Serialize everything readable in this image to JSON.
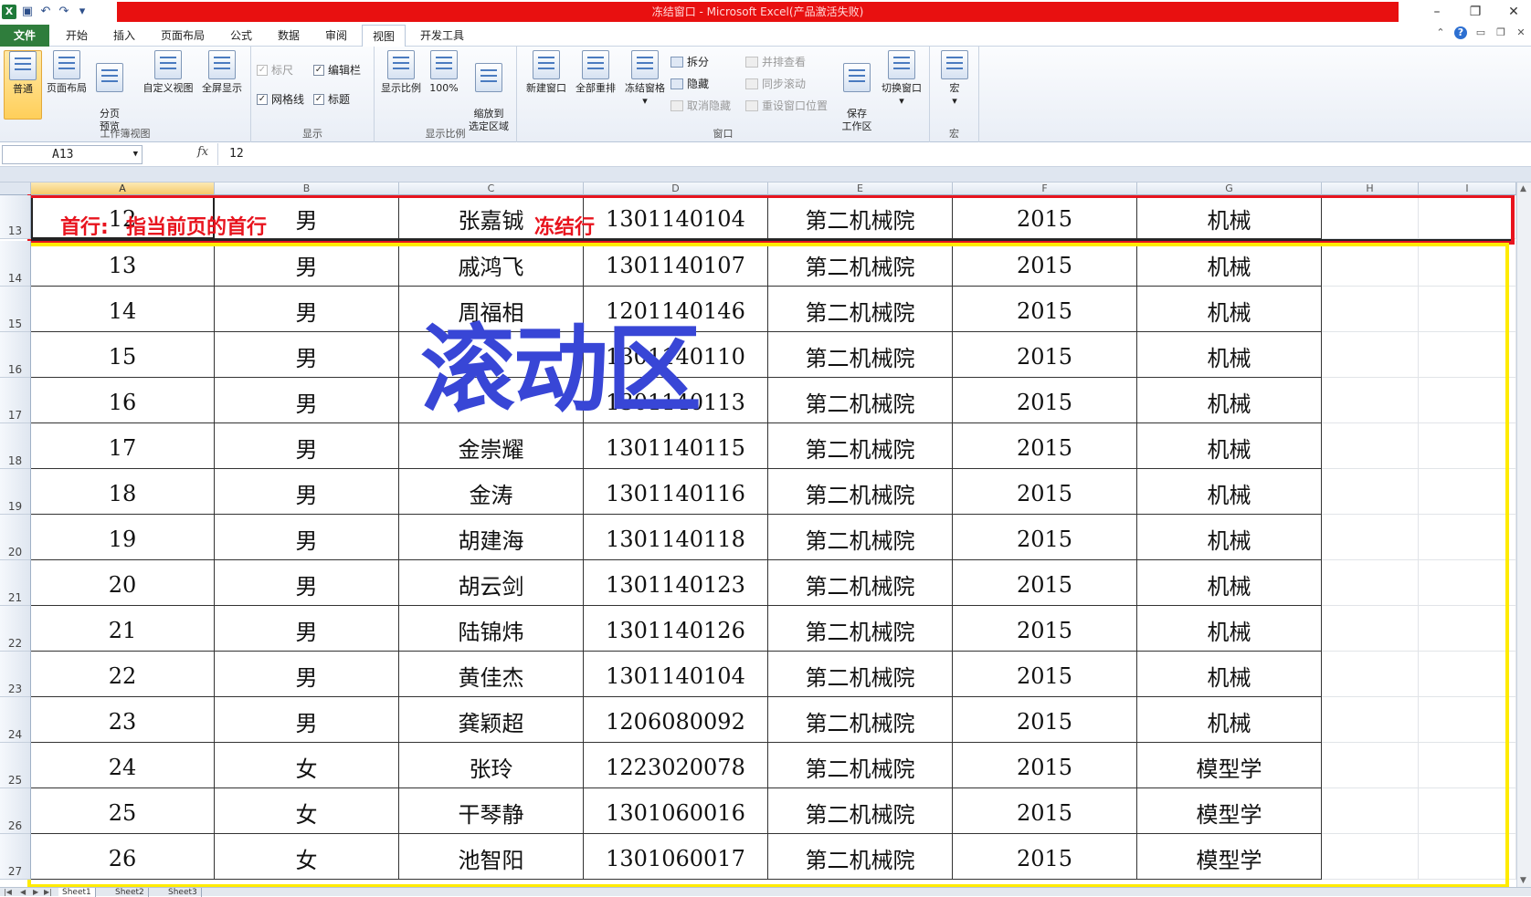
{
  "window": {
    "title": "冻结窗口 - Microsoft Excel(产品激活失败)",
    "controls": [
      "–",
      "❐",
      "✕"
    ]
  },
  "tabs": [
    "文件",
    "开始",
    "插入",
    "页面布局",
    "公式",
    "数据",
    "审阅",
    "视图",
    "开发工具"
  ],
  "ribbon": {
    "workbook_views": {
      "label": "工作簿视图",
      "normal": "普通",
      "page_layout": "页面布局",
      "page_break": "分页\n预览",
      "custom_views": "自定义视图",
      "full_screen": "全屏显示"
    },
    "show": {
      "label": "显示",
      "ruler": "标尺",
      "formula_bar": "编辑栏",
      "gridlines": "网格线",
      "headings": "标题"
    },
    "zoom": {
      "label": "显示比例",
      "zoom": "显示比例",
      "zoom100": "100%",
      "zoom_selection": "缩放到\n选定区域"
    },
    "window": {
      "label": "窗口",
      "new_window": "新建窗口",
      "arrange_all": "全部重排",
      "freeze_panes": "冻结窗格",
      "split": "拆分",
      "hide": "隐藏",
      "unhide": "取消隐藏",
      "side_by_side": "并排查看",
      "sync_scroll": "同步滚动",
      "reset_position": "重设窗口位置",
      "save_workspace": "保存\n工作区",
      "switch_windows": "切换窗口"
    },
    "macros": {
      "label": "宏",
      "macros": "宏"
    }
  },
  "formula_bar": {
    "name_box": "A13",
    "fx": "fx",
    "value": "12"
  },
  "columns": [
    "A",
    "B",
    "C",
    "D",
    "E",
    "F",
    "G",
    "H",
    "I"
  ],
  "rows": [
    {
      "num": "13",
      "cells": [
        "12",
        "男",
        "张嘉铖",
        "1301140104",
        "第二机械院",
        "2015",
        "机械"
      ]
    },
    {
      "num": "14",
      "cells": [
        "13",
        "男",
        "戚鸿飞",
        "1301140107",
        "第二机械院",
        "2015",
        "机械"
      ]
    },
    {
      "num": "15",
      "cells": [
        "14",
        "男",
        "周福相",
        "1201140146",
        "第二机械院",
        "2015",
        "机械"
      ]
    },
    {
      "num": "16",
      "cells": [
        "15",
        "男",
        "",
        "1301140110",
        "第二机械院",
        "2015",
        "机械"
      ]
    },
    {
      "num": "17",
      "cells": [
        "16",
        "男",
        "",
        "1301140113",
        "第二机械院",
        "2015",
        "机械"
      ]
    },
    {
      "num": "18",
      "cells": [
        "17",
        "男",
        "金崇耀",
        "1301140115",
        "第二机械院",
        "2015",
        "机械"
      ]
    },
    {
      "num": "19",
      "cells": [
        "18",
        "男",
        "金涛",
        "1301140116",
        "第二机械院",
        "2015",
        "机械"
      ]
    },
    {
      "num": "20",
      "cells": [
        "19",
        "男",
        "胡建海",
        "1301140118",
        "第二机械院",
        "2015",
        "机械"
      ]
    },
    {
      "num": "21",
      "cells": [
        "20",
        "男",
        "胡云剑",
        "1301140123",
        "第二机械院",
        "2015",
        "机械"
      ]
    },
    {
      "num": "22",
      "cells": [
        "21",
        "男",
        "陆锦炜",
        "1301140126",
        "第二机械院",
        "2015",
        "机械"
      ]
    },
    {
      "num": "23",
      "cells": [
        "22",
        "男",
        "黄佳杰",
        "1301140104",
        "第二机械院",
        "2015",
        "机械"
      ]
    },
    {
      "num": "24",
      "cells": [
        "23",
        "男",
        "龚颖超",
        "1206080092",
        "第二机械院",
        "2015",
        "机械"
      ]
    },
    {
      "num": "25",
      "cells": [
        "24",
        "女",
        "张玲",
        "1223020078",
        "第二机械院",
        "2015",
        "模型学"
      ]
    },
    {
      "num": "26",
      "cells": [
        "25",
        "女",
        "干琴静",
        "1301060016",
        "第二机械院",
        "2015",
        "模型学"
      ]
    },
    {
      "num": "27",
      "cells": [
        "26",
        "女",
        "池智阳",
        "1301060017",
        "第二机械院",
        "2015",
        "模型学"
      ]
    }
  ],
  "annotations": {
    "first_row": "首行:",
    "first_row_desc": "指当前页的首行",
    "frozen_row": "冻结行",
    "scroll_area": "滚动区"
  },
  "sheets": [
    "Sheet1",
    "Sheet2",
    "Sheet3"
  ],
  "colors": {
    "title_bar": "#e81010",
    "frozen_box": "#e8141e",
    "scroll_box": "#ffeb00",
    "scroll_label": "#3846d6",
    "file_tab": "#2f7d3c"
  }
}
